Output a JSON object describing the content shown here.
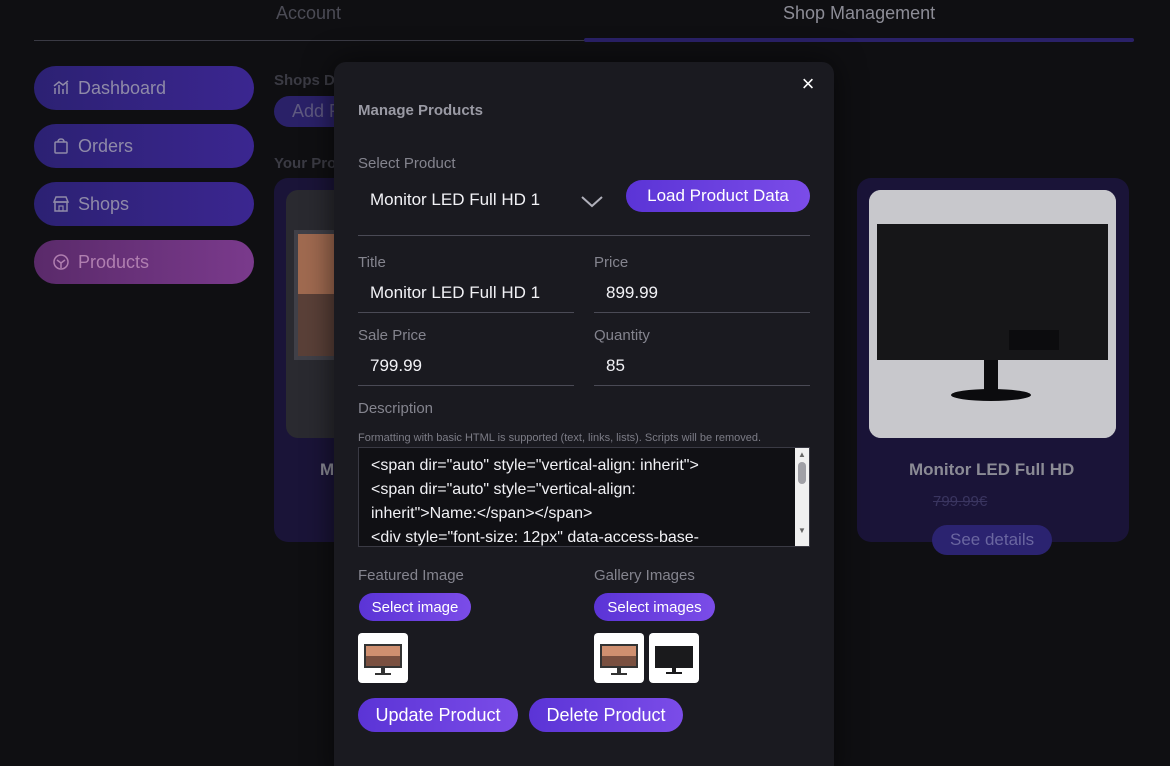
{
  "top_tabs": {
    "account": "Account",
    "shop_management": "Shop Management"
  },
  "sidebar": {
    "items": [
      {
        "label": "Dashboard",
        "icon": "chart-icon"
      },
      {
        "label": "Orders",
        "icon": "bag-icon"
      },
      {
        "label": "Shops",
        "icon": "store-icon"
      },
      {
        "label": "Products",
        "icon": "product-icon"
      }
    ],
    "active": "Products"
  },
  "background": {
    "shops_heading": "Shops D",
    "add_button": "Add P",
    "your_products_heading": "Your Pro",
    "left_card_title": "M",
    "right_card": {
      "title": "Monitor LED Full HD",
      "price": "799.99€",
      "details_button": "See details"
    }
  },
  "modal": {
    "title": "Manage Products",
    "close_icon": "×",
    "select_product_label": "Select Product",
    "selected_product": "Monitor LED Full HD 1",
    "load_button": "Load Product Data",
    "title_label": "Title",
    "title_value": "Monitor LED Full HD 1",
    "price_label": "Price",
    "price_value": "899.99",
    "sale_price_label": "Sale Price",
    "sale_price_value": "799.99",
    "quantity_label": "Quantity",
    "quantity_value": "85",
    "description_label": "Description",
    "description_hint": "Formatting with basic HTML is supported (text, links, lists). Scripts will be removed.",
    "description_lines": [
      "<span dir=\"auto\" style=\"vertical-align: inherit\">",
      "<span dir=\"auto\" style=\"vertical-align:",
      "inherit\">Name:</span></span>",
      "<div style=\"font-size: 12px\" data-access-base-"
    ],
    "featured_image_label": "Featured Image",
    "select_image_button": "Select image",
    "gallery_images_label": "Gallery Images",
    "select_images_button": "Select images",
    "update_button": "Update Product",
    "delete_button": "Delete Product"
  },
  "colors": {
    "accent": "#6a3fe0",
    "background": "#0f0f12",
    "modal": "#1a1a20"
  }
}
